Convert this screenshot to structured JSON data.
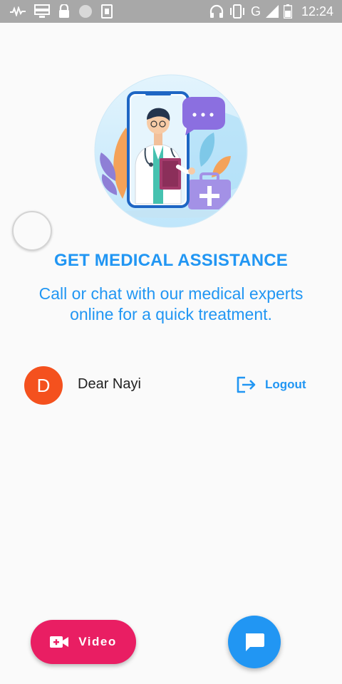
{
  "status_bar": {
    "network": "G",
    "time": "12:24",
    "icons": [
      "signal-wave-icon",
      "storage-icon",
      "lock-icon",
      "circle-icon",
      "sim-icon",
      "headphones-icon",
      "vibrate-icon",
      "signal-bars-icon",
      "battery-icon"
    ]
  },
  "hero": {
    "illustration": "doctor-on-phone-illustration"
  },
  "content": {
    "title": "GET MEDICAL ASSISTANCE",
    "subtitle_line1": "Call or chat with our medical experts",
    "subtitle_line2": "online for a quick treatment."
  },
  "user": {
    "avatar_initial": "D",
    "name": "Dear Nayi",
    "avatar_color": "#f4511e"
  },
  "logout": {
    "label": "Logout",
    "icon": "logout-icon"
  },
  "actions": {
    "video_label": "Video",
    "video_icon": "video-call-icon",
    "chat_icon": "chat-icon"
  },
  "colors": {
    "primary": "#2196f3",
    "video_button": "#e91e63",
    "background": "#fafafa",
    "status_bar": "#a8a8a8"
  }
}
